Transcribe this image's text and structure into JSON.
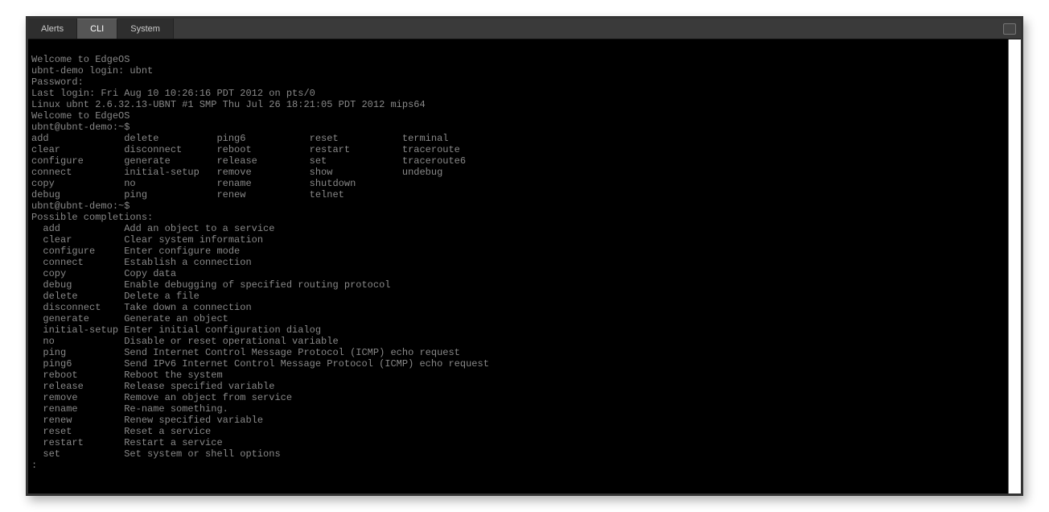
{
  "tabs": [
    {
      "label": "Alerts",
      "active": false
    },
    {
      "label": "CLI",
      "active": true
    },
    {
      "label": "System",
      "active": false
    }
  ],
  "terminal": {
    "banner": [
      "Welcome to EdgeOS",
      "ubnt-demo login: ubnt",
      "Password:",
      "Last login: Fri Aug 10 10:26:16 PDT 2012 on pts/0",
      "Linux ubnt 2.6.32.13-UBNT #1 SMP Thu Jul 26 18:21:05 PDT 2012 mips64",
      "Welcome to EdgeOS"
    ],
    "prompt1": "ubnt@ubnt-demo:~$",
    "command_columns": [
      [
        "add",
        "clear",
        "configure",
        "connect",
        "copy",
        "debug"
      ],
      [
        "delete",
        "disconnect",
        "generate",
        "initial-setup",
        "no",
        "ping"
      ],
      [
        "ping6",
        "reboot",
        "release",
        "remove",
        "rename",
        "renew"
      ],
      [
        "reset",
        "restart",
        "set",
        "show",
        "shutdown",
        "telnet"
      ],
      [
        "terminal",
        "traceroute",
        "traceroute6",
        "undebug",
        "",
        ""
      ]
    ],
    "prompt2": "ubnt@ubnt-demo:~$",
    "completions_header": "Possible completions:",
    "completions": [
      {
        "cmd": "add",
        "desc": "Add an object to a service"
      },
      {
        "cmd": "clear",
        "desc": "Clear system information"
      },
      {
        "cmd": "configure",
        "desc": "Enter configure mode"
      },
      {
        "cmd": "connect",
        "desc": "Establish a connection"
      },
      {
        "cmd": "copy",
        "desc": "Copy data"
      },
      {
        "cmd": "debug",
        "desc": "Enable debugging of specified routing protocol"
      },
      {
        "cmd": "delete",
        "desc": "Delete a file"
      },
      {
        "cmd": "disconnect",
        "desc": "Take down a connection"
      },
      {
        "cmd": "generate",
        "desc": "Generate an object"
      },
      {
        "cmd": "initial-setup",
        "desc": "Enter initial configuration dialog"
      },
      {
        "cmd": "no",
        "desc": "Disable or reset operational variable"
      },
      {
        "cmd": "ping",
        "desc": "Send Internet Control Message Protocol (ICMP) echo request"
      },
      {
        "cmd": "ping6",
        "desc": "Send IPv6 Internet Control Message Protocol (ICMP) echo request"
      },
      {
        "cmd": "reboot",
        "desc": "Reboot the system"
      },
      {
        "cmd": "release",
        "desc": "Release specified variable"
      },
      {
        "cmd": "remove",
        "desc": "Remove an object from service"
      },
      {
        "cmd": "rename",
        "desc": "Re-name something."
      },
      {
        "cmd": "renew",
        "desc": "Renew specified variable"
      },
      {
        "cmd": "reset",
        "desc": "Reset a service"
      },
      {
        "cmd": "restart",
        "desc": "Restart a service"
      },
      {
        "cmd": "set",
        "desc": "Set system or shell options"
      }
    ],
    "pager_prompt": ":"
  }
}
